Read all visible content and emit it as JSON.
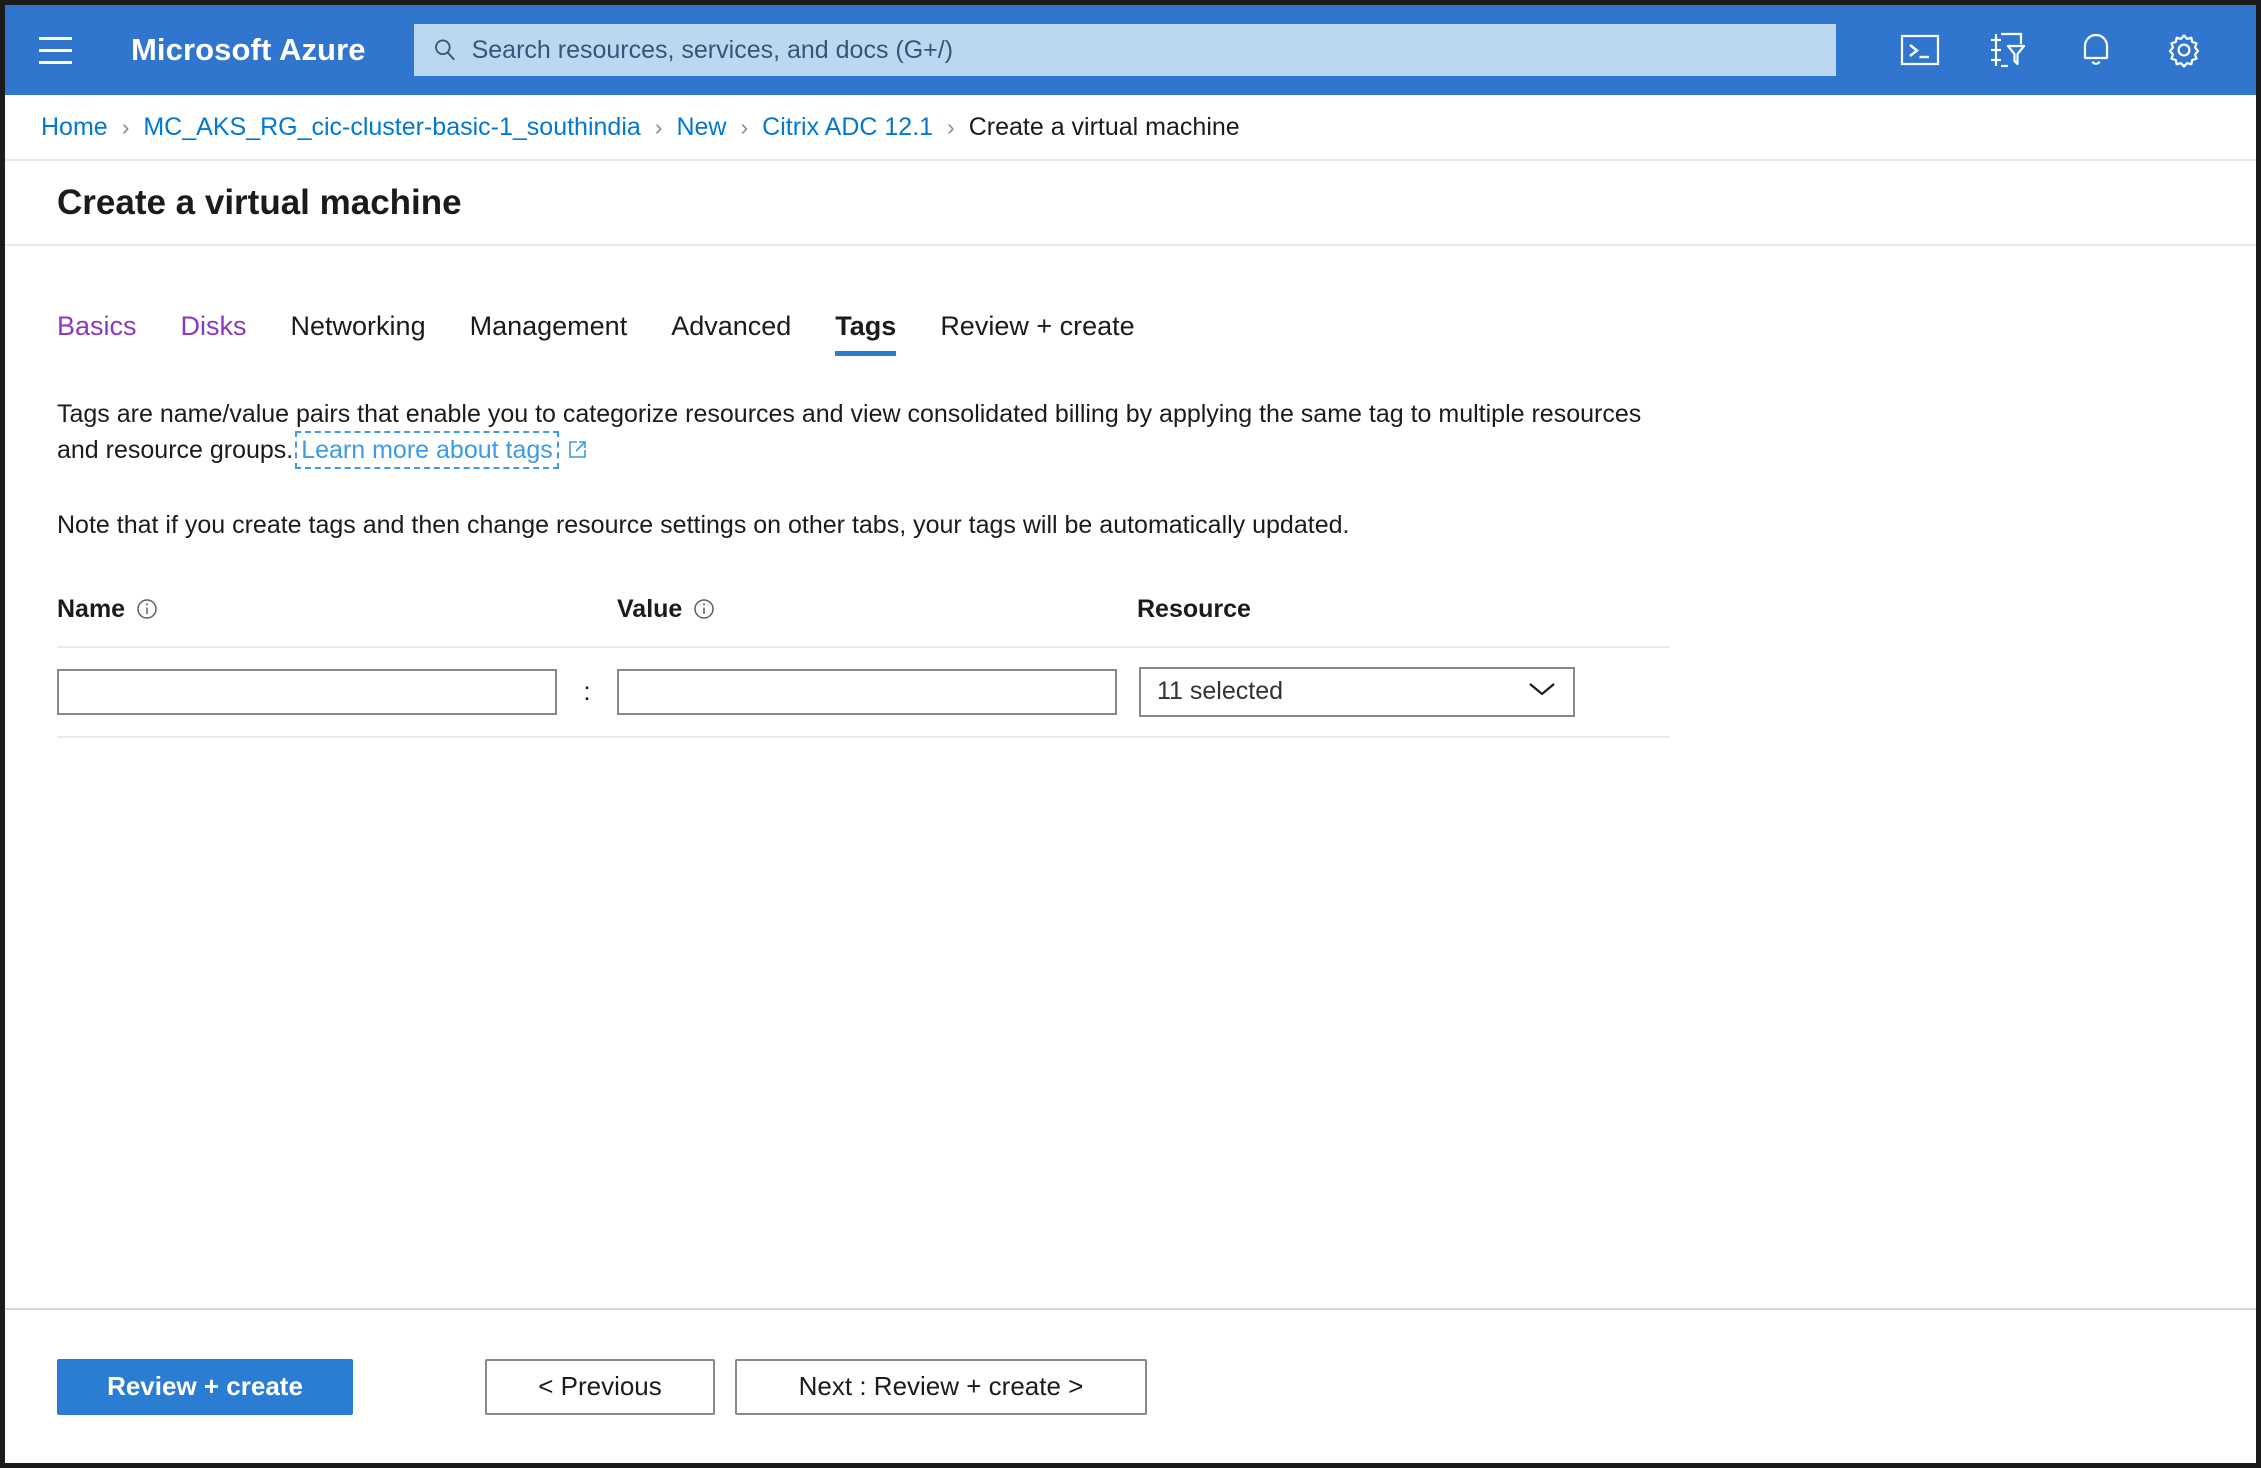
{
  "topbar": {
    "menu_icon": "hamburger-icon",
    "brand": "Microsoft Azure",
    "search_placeholder": "Search resources, services, and docs (G+/)",
    "search_value": "",
    "search_icon": "search-icon",
    "icons": [
      {
        "name": "cloud-shell-icon",
        "label": "Cloud Shell"
      },
      {
        "name": "directory-filter-icon",
        "label": "Directories + subscriptions"
      },
      {
        "name": "notifications-bell-icon",
        "label": "Notifications"
      },
      {
        "name": "settings-gear-icon",
        "label": "Settings"
      }
    ]
  },
  "breadcrumb": {
    "separator": "›",
    "items": [
      {
        "label": "Home",
        "link": true
      },
      {
        "label": "MC_AKS_RG_cic-cluster-basic-1_southindia",
        "link": true
      },
      {
        "label": "New",
        "link": true
      },
      {
        "label": "Citrix ADC 12.1",
        "link": true
      },
      {
        "label": "Create a virtual machine",
        "link": false
      }
    ]
  },
  "page": {
    "title": "Create a virtual machine"
  },
  "tabs": [
    {
      "label": "Basics",
      "state": "visited"
    },
    {
      "label": "Disks",
      "state": "visited"
    },
    {
      "label": "Networking",
      "state": "default"
    },
    {
      "label": "Management",
      "state": "default"
    },
    {
      "label": "Advanced",
      "state": "default"
    },
    {
      "label": "Tags",
      "state": "active"
    },
    {
      "label": "Review + create",
      "state": "default"
    }
  ],
  "description": {
    "text_before": "Tags are name/value pairs that enable you to categorize resources and view consolidated billing by applying the same tag to multiple resources and resource groups.",
    "link_label": "Learn more about tags",
    "link_icon": "external-link-icon",
    "note": "Note that if you create tags and then change resource settings on other tabs, your tags will be automatically updated."
  },
  "tag_table": {
    "headers": [
      {
        "label": "Name",
        "info": true
      },
      {
        "label": "Value",
        "info": true
      },
      {
        "label": "Resource",
        "info": false
      }
    ],
    "separator": ":",
    "rows": [
      {
        "name_value": "",
        "name_placeholder": "",
        "value_value": "",
        "value_placeholder": "",
        "resource_selected": "11 selected",
        "resource_chevron": "chevron-down-icon"
      }
    ]
  },
  "footer": {
    "review_create_label": "Review + create",
    "previous_label": "< Previous",
    "next_label": "Next : Review + create >"
  },
  "colors": {
    "header_blue": "#3076ce",
    "search_blue": "#bcd8f0",
    "accent_blue": "#2b7cd3",
    "link_blue": "#0078d4",
    "visited_purple": "#8b39bd",
    "learn_link_blue": "#3c9ae8",
    "text_dark": "#1b1b1b",
    "border_gray": "#8a8886",
    "divider_gray": "#ececed"
  }
}
